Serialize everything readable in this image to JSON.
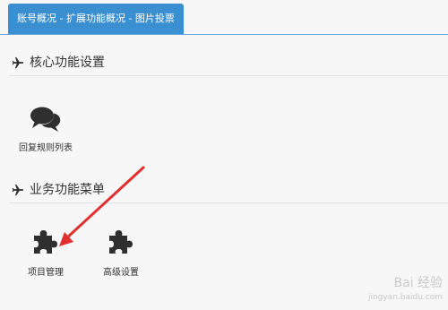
{
  "tabs": [
    {
      "label": "账号概况 - 扩展功能概况 - 图片投票",
      "active": true
    }
  ],
  "sections": [
    {
      "title": "核心功能设置",
      "items": [
        {
          "label": "回复规则列表",
          "icon": "chat-bubbles-icon"
        }
      ]
    },
    {
      "title": "业务功能菜单",
      "items": [
        {
          "label": "项目管理",
          "icon": "puzzle-icon"
        },
        {
          "label": "高级设置",
          "icon": "puzzle-icon"
        }
      ]
    }
  ],
  "watermark": {
    "text": "Bai 经验",
    "sub": "jingyan.baidu.com"
  },
  "colors": {
    "accent": "#3a8fd0",
    "annotation_arrow": "#e03030",
    "icon": "#2f2f2f"
  }
}
